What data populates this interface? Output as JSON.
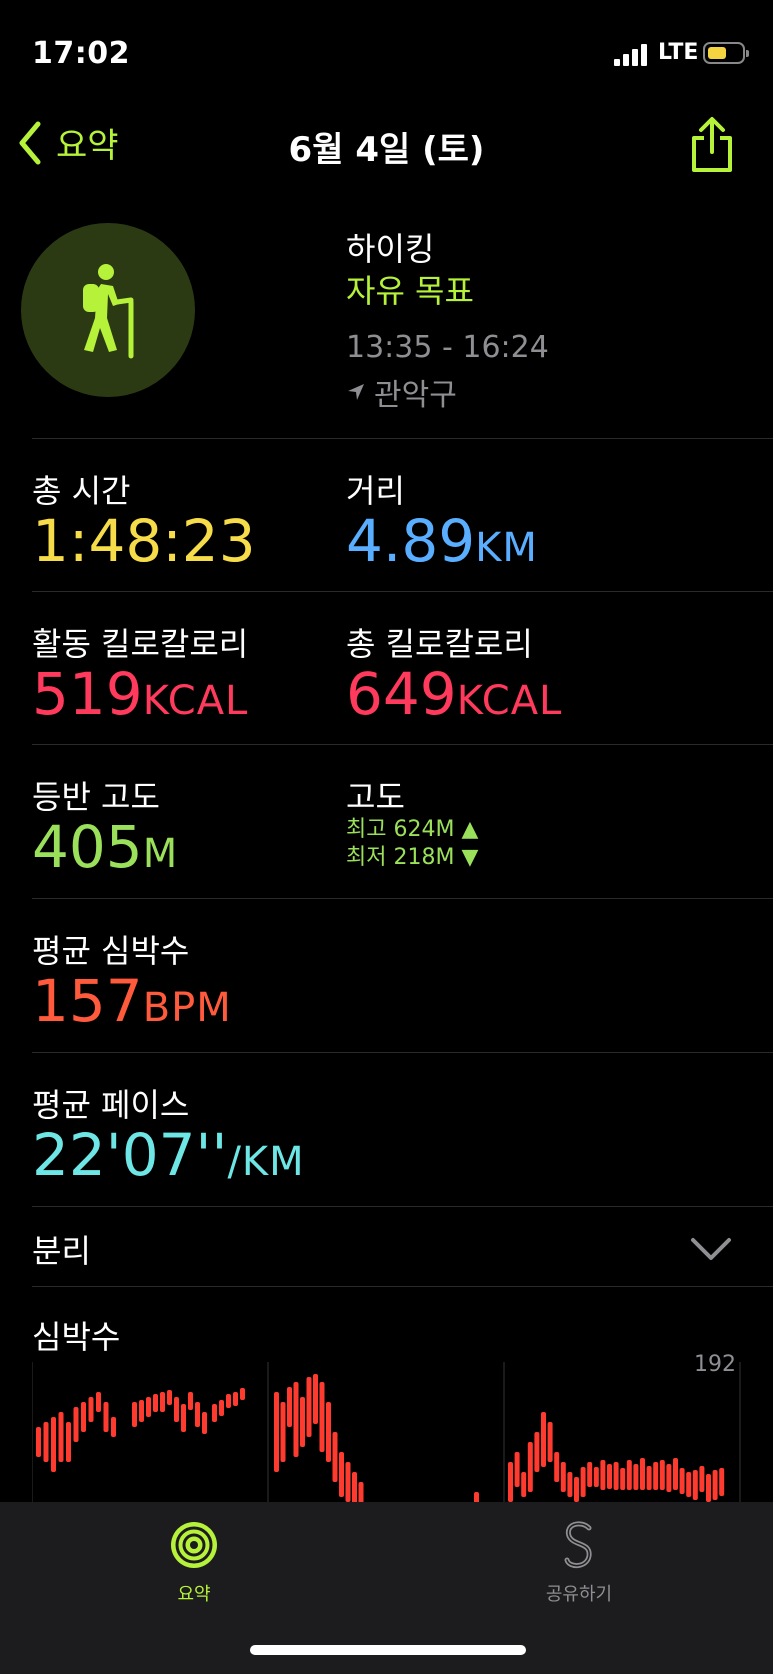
{
  "status": {
    "time": "17:02",
    "network": "LTE"
  },
  "nav": {
    "back_label": "요약",
    "title": "6월 4일 (토)"
  },
  "workout": {
    "type": "하이킹",
    "goal": "자유 목표",
    "time_range": "13:35 - 16:24",
    "location": "관악구"
  },
  "metrics": {
    "total_time": {
      "label": "총 시간",
      "value": "1:48:23",
      "color": "#f7dc4a"
    },
    "distance": {
      "label": "거리",
      "value": "4.89",
      "unit": "KM",
      "color": "#5aaeff"
    },
    "active_cal": {
      "label": "활동 킬로칼로리",
      "value": "519",
      "unit": "KCAL",
      "color": "#ff3a5c"
    },
    "total_cal": {
      "label": "총 킬로칼로리",
      "value": "649",
      "unit": "KCAL",
      "color": "#ff3a5c"
    },
    "elev_gain": {
      "label": "등반 고도",
      "value": "405",
      "unit": "M",
      "color": "#9be05a"
    },
    "elevation": {
      "label": "고도",
      "max": "최고 624M ▲",
      "min": "최저 218M ▼"
    },
    "avg_hr": {
      "label": "평균 심박수",
      "value": "157",
      "unit": "BPM",
      "color": "#ff5a3c"
    },
    "avg_pace": {
      "label": "평균 페이스",
      "value": "22'07''",
      "unit": "/KM",
      "color": "#6ee6e6"
    }
  },
  "splits": {
    "label": "분리"
  },
  "heart_rate": {
    "label": "심박수",
    "max_label": "192"
  },
  "tabs": [
    {
      "label": "요약",
      "active": true
    },
    {
      "label": "공유하기",
      "active": false
    }
  ]
}
